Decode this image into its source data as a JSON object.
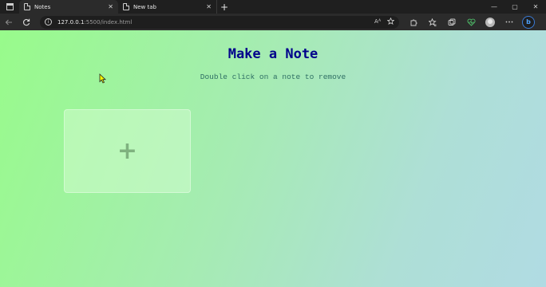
{
  "browser": {
    "tabs": [
      {
        "label": "Notes",
        "close": "✕",
        "active": true
      },
      {
        "label": "New tab",
        "close": "✕",
        "active": false
      }
    ],
    "new_tab": "+",
    "caption": {
      "minimize": "—",
      "maximize": "▢",
      "close": "✕"
    },
    "address": {
      "host": "127.0.0.1",
      "rest": ":5500/index.html"
    },
    "icons": [
      "back-icon",
      "refresh-icon",
      "info-icon",
      "read-aloud-icon",
      "favorite-icon",
      "extensions-icon",
      "favorites-icon",
      "collections-icon",
      "browser-essentials-icon",
      "profile-avatar",
      "more-icon",
      "bing-icon"
    ]
  },
  "page": {
    "title": "Make a Note",
    "subtitle": "Double click on a note to remove",
    "add_button": "+"
  },
  "colors": {
    "title": "#00008b",
    "subtitle": "#2f6f64",
    "gradient_start": "#98fb8b",
    "gradient_end": "#b0dbe3"
  }
}
